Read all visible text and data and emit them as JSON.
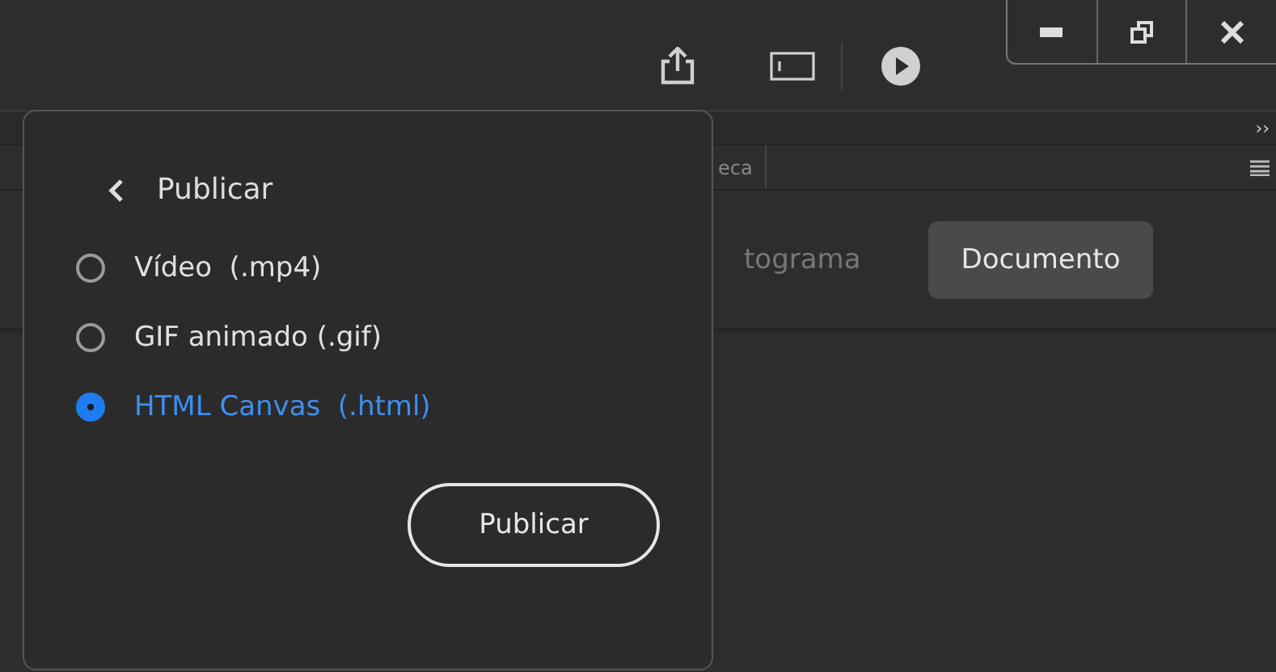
{
  "panel_tabs": {
    "partial_tab": "eca",
    "overflow": "››"
  },
  "view_tabs": [
    {
      "label": "tograma",
      "selected": false
    },
    {
      "label": "Documento",
      "selected": true
    }
  ],
  "publish_menu": {
    "title": "Publicar",
    "options": [
      {
        "label": "Vídeo  (.mp4)",
        "selected": false
      },
      {
        "label": "GIF animado (.gif)",
        "selected": false
      },
      {
        "label": "HTML Canvas  (.html)",
        "selected": true
      }
    ],
    "button": "Publicar"
  }
}
